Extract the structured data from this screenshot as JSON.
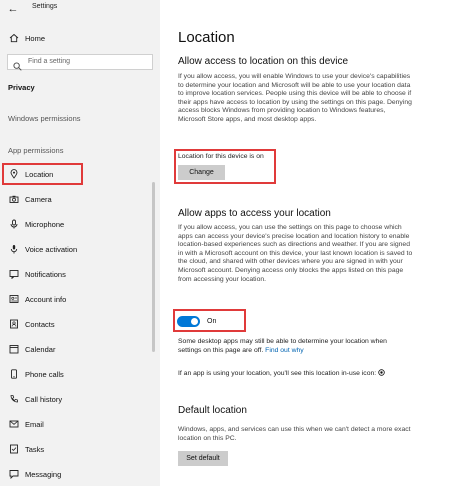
{
  "window": {
    "title": "Settings"
  },
  "sidebar": {
    "home_label": "Home",
    "search_placeholder": "Find a setting",
    "privacy_label": "Privacy",
    "windows_permissions_heading": "Windows permissions",
    "app_permissions_heading": "App permissions",
    "items": [
      {
        "label": "Location",
        "icon": "location-icon"
      },
      {
        "label": "Camera",
        "icon": "camera-icon"
      },
      {
        "label": "Microphone",
        "icon": "microphone-icon"
      },
      {
        "label": "Voice activation",
        "icon": "voice-activation-icon"
      },
      {
        "label": "Notifications",
        "icon": "notifications-icon"
      },
      {
        "label": "Account info",
        "icon": "account-info-icon"
      },
      {
        "label": "Contacts",
        "icon": "contacts-icon"
      },
      {
        "label": "Calendar",
        "icon": "calendar-icon"
      },
      {
        "label": "Phone calls",
        "icon": "phone-calls-icon"
      },
      {
        "label": "Call history",
        "icon": "call-history-icon"
      },
      {
        "label": "Email",
        "icon": "email-icon"
      },
      {
        "label": "Tasks",
        "icon": "tasks-icon"
      },
      {
        "label": "Messaging",
        "icon": "messaging-icon"
      }
    ]
  },
  "main": {
    "title": "Location",
    "access_section": {
      "heading": "Allow access to location on this device",
      "description": "If you allow access, you will enable Windows to use your device's capabilities to determine your location and Microsoft will be able to use your location data to improve location services. People using this device will be able to choose if their apps have access to location by using the settings on this page. Denying access blocks Windows from providing location to Windows features, Microsoft Store apps, and most desktop apps.",
      "status": "Location for this device is on",
      "change_button": "Change"
    },
    "apps_section": {
      "heading": "Allow apps to access your location",
      "description": "If you allow access, you can use the settings on this page to choose which apps can access your device's precise location and location history to enable location-based experiences such as directions and weather. If you are signed in with a Microsoft account on this device, your last known location is saved to the cloud, and shared with other devices where you are signed in with your Microsoft account. Denying access only blocks the apps listed on this page from accessing your location.",
      "toggle_state": "On",
      "desktop_note_1": "Some desktop apps may still be able to determine your location when",
      "desktop_note_2": "settings on this page are off.",
      "find_out_why": "Find out why",
      "in_use_note": "If an app is using your location, you'll see this location in-use icon:"
    },
    "default_section": {
      "heading": "Default location",
      "description": "Windows, apps, and services can use this when we can't detect a more exact location on this PC.",
      "set_default_button": "Set default"
    }
  },
  "colors": {
    "accent": "#0078d7",
    "highlight": "#e03a3a",
    "sidebar_bg": "#f2f2f2"
  }
}
